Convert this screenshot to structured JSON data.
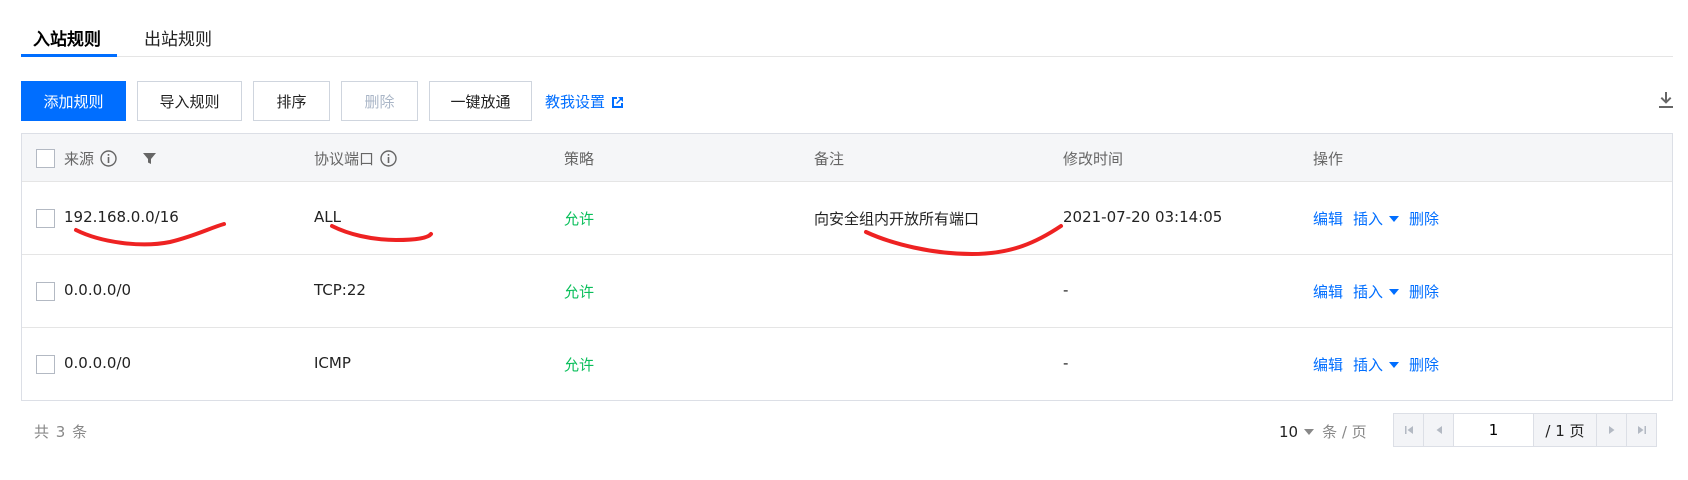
{
  "tabs": [
    {
      "label": "入站规则",
      "active": true
    },
    {
      "label": "出站规则",
      "active": false
    }
  ],
  "toolbar": {
    "add_label": "添加规则",
    "import_label": "导入规则",
    "sort_label": "排序",
    "delete_label": "删除",
    "open_all_label": "一键放通",
    "help_link": "教我设置"
  },
  "table": {
    "headers": {
      "source": "来源",
      "protocol_port": "协议端口",
      "policy": "策略",
      "remark": "备注",
      "modified": "修改时间",
      "actions": "操作"
    },
    "rows": [
      {
        "source": "192.168.0.0/16",
        "protocol": "ALL",
        "policy": "允许",
        "remark": "向安全组内开放所有端口",
        "modified": "2021-07-20 03:14:05"
      },
      {
        "source": "0.0.0.0/0",
        "protocol": "TCP:22",
        "policy": "允许",
        "remark": "",
        "modified": "-"
      },
      {
        "source": "0.0.0.0/0",
        "protocol": "ICMP",
        "policy": "允许",
        "remark": "",
        "modified": "-"
      }
    ],
    "actions": {
      "edit": "编辑",
      "insert": "插入",
      "delete": "删除"
    }
  },
  "footer": {
    "total": "共 3 条",
    "page_size": "10",
    "page_size_unit": "条 / 页",
    "current_page": "1",
    "total_pages": "/ 1 页"
  },
  "colors": {
    "primary": "#006eff",
    "allow": "#0abf5b",
    "annotation_red": "#ee2222"
  }
}
